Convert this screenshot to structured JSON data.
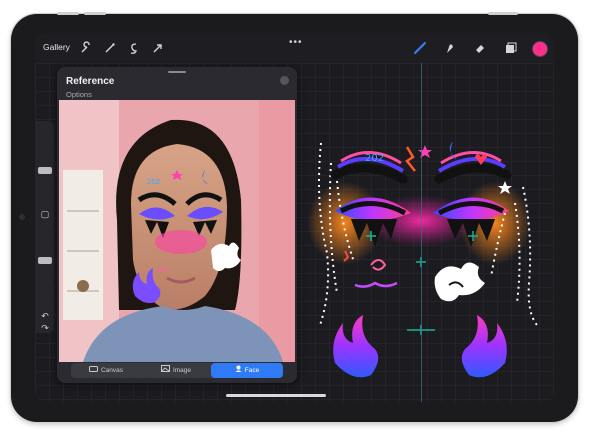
{
  "toolbar": {
    "gallery_label": "Gallery",
    "more_dots": "•••",
    "tools": [
      "wrench-icon",
      "magic-wand-icon",
      "selection-icon",
      "transform-arrow-icon"
    ],
    "right_tools": [
      "brush-icon",
      "smudge-icon",
      "eraser-icon",
      "layers-icon"
    ],
    "active_color": "#ff2e8a"
  },
  "sidebar": {
    "undo_label": "↶",
    "redo_label": "↷",
    "modify_label": "▢"
  },
  "reference_panel": {
    "title": "Reference",
    "subtitle": "Options",
    "segments": [
      {
        "label": "Canvas",
        "icon": "canvas-icon",
        "active": false
      },
      {
        "label": "Image",
        "icon": "image-icon",
        "active": false
      },
      {
        "label": "Face",
        "icon": "face-icon",
        "active": true
      }
    ]
  },
  "colors": {
    "accent_blue": "#2f7bf5",
    "symmetry_guide": "#3f6f8a"
  }
}
